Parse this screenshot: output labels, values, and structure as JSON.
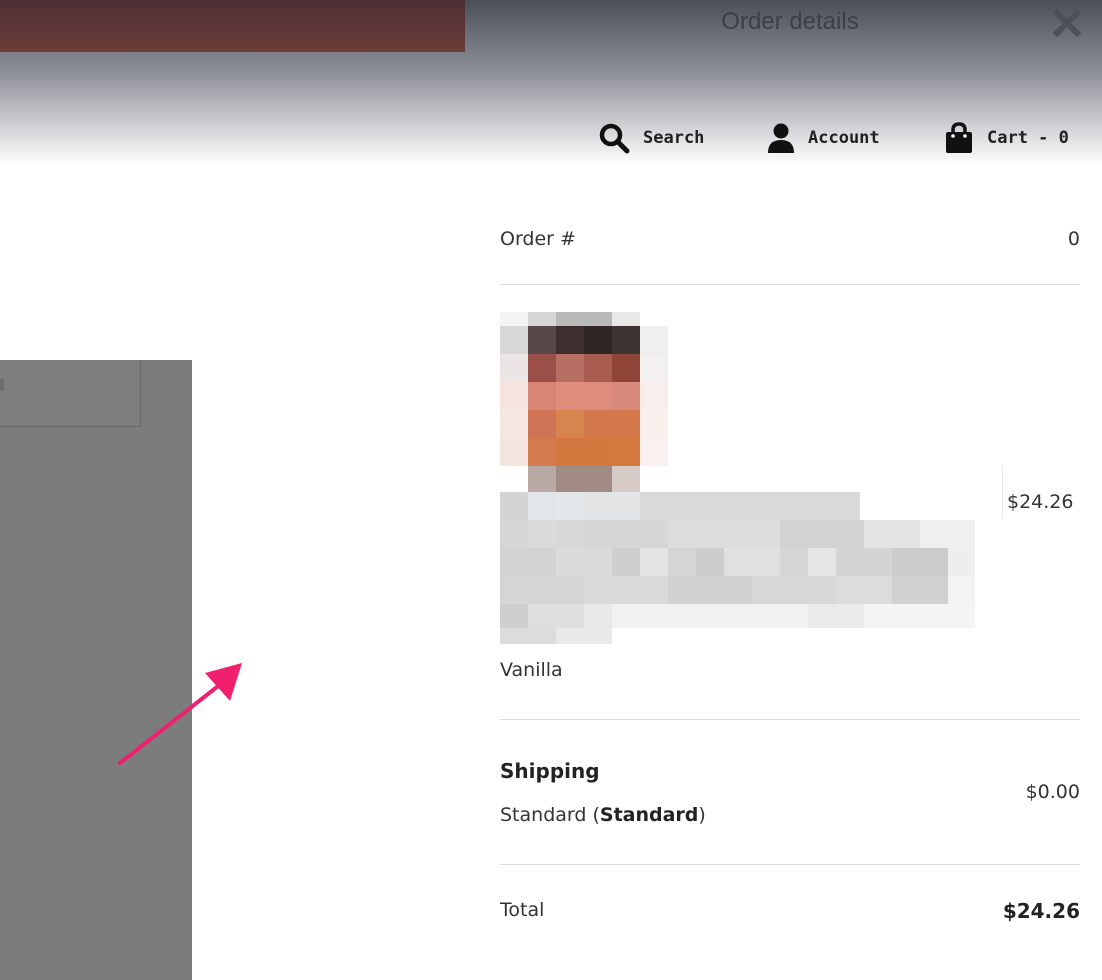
{
  "panel": {
    "title": "Order details"
  },
  "nav": {
    "search_label": "Search",
    "account_label": "Account",
    "cart_label": "Cart - 0"
  },
  "order": {
    "number_label": "Order #",
    "number_value": "0",
    "item": {
      "variant": "Vanilla",
      "price": "$24.26"
    },
    "shipping": {
      "heading": "Shipping",
      "method_prefix": "Standard (",
      "method_bold": "Standard",
      "method_suffix": ")",
      "price": "$0.00"
    },
    "total": {
      "label": "Total",
      "value": "$24.26"
    }
  },
  "colors": {
    "annotation_arrow": "#f0206f",
    "banner": "#6b3c3a"
  }
}
